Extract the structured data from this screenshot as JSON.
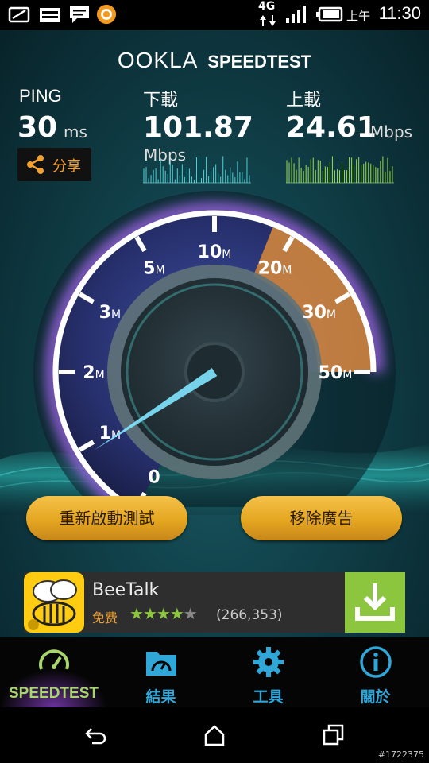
{
  "status_bar": {
    "network": "4G",
    "ampm": "上午",
    "time": "11:30"
  },
  "header": {
    "logo_left": "OOKLA",
    "logo_right": "SPEEDTEST"
  },
  "results": {
    "ping": {
      "label": "PING",
      "value": "30",
      "unit": "ms"
    },
    "download": {
      "label": "下載",
      "value": "101.87",
      "unit": "Mbps"
    },
    "upload": {
      "label": "上載",
      "value": "24.61",
      "unit": "Mbps"
    },
    "share_label": "分享"
  },
  "gauge": {
    "ticks": [
      {
        "num": "0",
        "suf": ""
      },
      {
        "num": "1",
        "suf": "M"
      },
      {
        "num": "2",
        "suf": "M"
      },
      {
        "num": "3",
        "suf": "M"
      },
      {
        "num": "5",
        "suf": "M"
      },
      {
        "num": "10",
        "suf": "M"
      },
      {
        "num": "20",
        "suf": "M"
      },
      {
        "num": "30",
        "suf": "M"
      },
      {
        "num": "50",
        "suf": "M"
      }
    ],
    "needle_value_mbps": 0.9,
    "colors": {
      "arc": "#ffffff",
      "glow": "#9a5cff",
      "upload_fill": "#d98a3a",
      "needle": "#7fe6ff"
    }
  },
  "buttons": {
    "retest": "重新啟動測試",
    "remove_ads": "移除廣告"
  },
  "ad": {
    "app_name": "BeeTalk",
    "price": "免费",
    "rating": 4,
    "rating_max": 5,
    "reviews": "(266,353)",
    "colors": {
      "icon_bg": "#ffcc11",
      "download_bg": "#8cc63f"
    }
  },
  "tabs": [
    {
      "label": "SPEEDTEST",
      "icon": "speedometer-icon",
      "active": true
    },
    {
      "label": "結果",
      "icon": "folder-gauge-icon",
      "active": false
    },
    {
      "label": "工具",
      "icon": "gear-icon",
      "active": false
    },
    {
      "label": "關於",
      "icon": "info-icon",
      "active": false
    }
  ],
  "watermark": "#1722375"
}
